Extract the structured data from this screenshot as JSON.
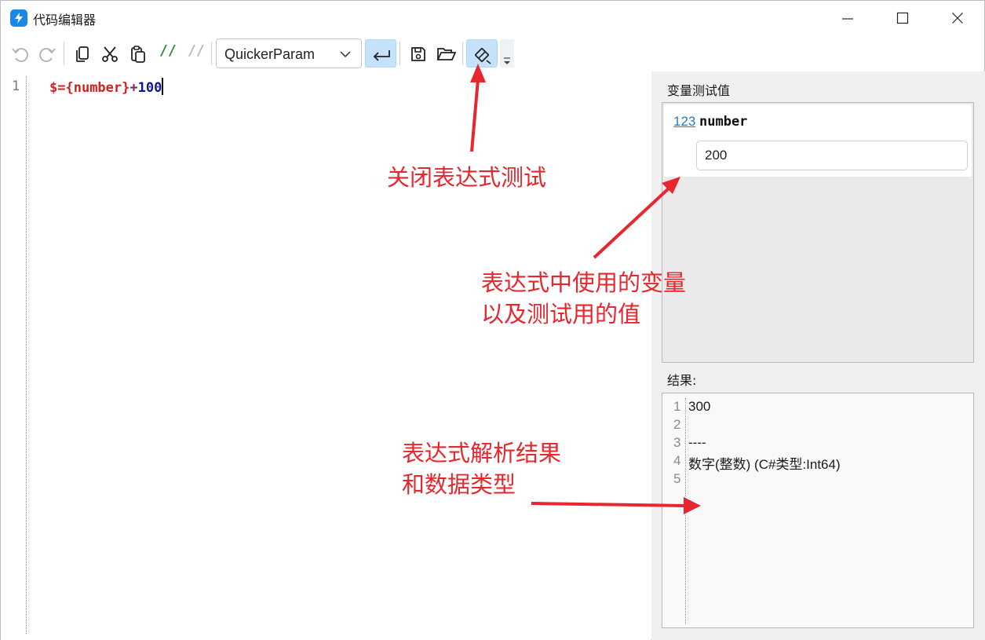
{
  "window": {
    "title": "代码编辑器",
    "app_icon": "quicker-bolt-icon",
    "controls": [
      "minimize-icon",
      "maximize-icon",
      "close-icon"
    ]
  },
  "toolbar": {
    "buttons": [
      "undo-icon",
      "redo-icon",
      "copy-icon",
      "cut-icon",
      "paste-icon",
      "comment-icon",
      "uncomment-icon",
      "word-wrap-icon",
      "save-icon",
      "open-folder-icon",
      "expression-test-icon",
      "overflow-icon"
    ],
    "comment_glyph": "//",
    "uncomment_glyph": "//",
    "language_select": {
      "value": "QuickerParam"
    }
  },
  "editor": {
    "lines": [
      {
        "num": "1",
        "tokens": [
          {
            "text": "$=",
            "kind": "var"
          },
          {
            "text": "{number}",
            "kind": "var"
          },
          {
            "text": "+",
            "kind": "op"
          },
          {
            "text": "100",
            "kind": "num"
          }
        ]
      }
    ]
  },
  "right_panel": {
    "vars_label": "变量测试值",
    "variable": {
      "type_icon": "123",
      "name": "number",
      "value": "200"
    },
    "result_label": "结果:",
    "result": {
      "line_numbers": [
        "1",
        "2",
        "3",
        "4",
        "5"
      ],
      "lines": [
        "300",
        "",
        "----",
        "数字(整数) (C#类型:Int64)",
        ""
      ]
    }
  },
  "annotations": {
    "close_test": "关闭表达式测试",
    "vars_note_1": "表达式中使用的变量",
    "vars_note_2": "以及测试用的值",
    "result_note_1": "表达式解析结果",
    "result_note_2": "和数据类型"
  },
  "colors": {
    "accent": "#1a88e6",
    "active_button": "#c4e2fb",
    "annotation": "#e8262d",
    "token_var": "#d42020",
    "token_num": "#14148c",
    "comment_green": "#2e8b2e"
  }
}
